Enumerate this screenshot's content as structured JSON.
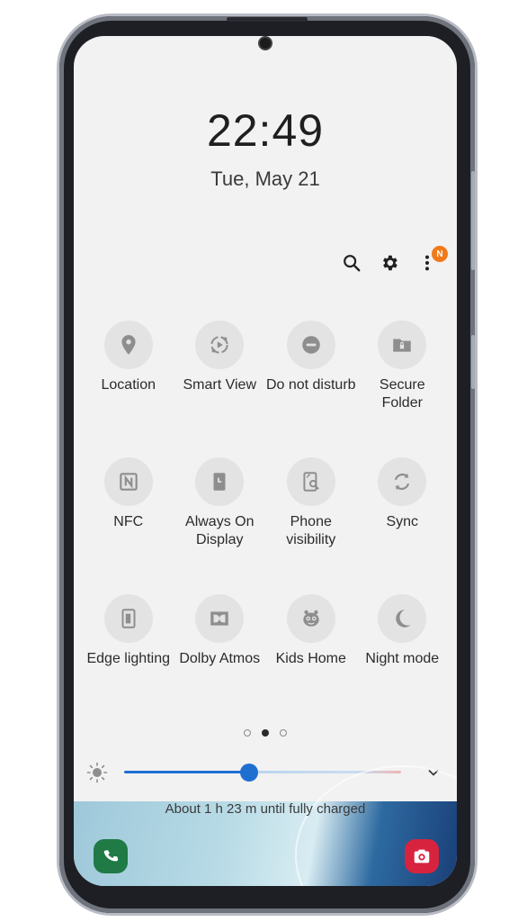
{
  "lockscreen": {
    "time": "22:49",
    "date": "Tue, May 21"
  },
  "top_actions": {
    "notification_badge": "N"
  },
  "tiles": [
    {
      "label": "Location",
      "icon": "location-pin-icon"
    },
    {
      "label": "Smart View",
      "icon": "smart-view-icon"
    },
    {
      "label": "Do not disturb",
      "icon": "do-not-disturb-icon"
    },
    {
      "label": "Secure Folder",
      "icon": "secure-folder-icon"
    },
    {
      "label": "NFC",
      "icon": "nfc-icon"
    },
    {
      "label": "Always On Display",
      "icon": "always-on-display-icon"
    },
    {
      "label": "Phone visibility",
      "icon": "phone-visibility-icon"
    },
    {
      "label": "Sync",
      "icon": "sync-icon"
    },
    {
      "label": "Edge lighting",
      "icon": "edge-lighting-icon"
    },
    {
      "label": "Dolby Atmos",
      "icon": "dolby-icon"
    },
    {
      "label": "Kids Home",
      "icon": "kids-home-icon"
    },
    {
      "label": "Night mode",
      "icon": "night-mode-icon"
    }
  ],
  "pager": {
    "pages": 3,
    "current": 2
  },
  "brightness": {
    "level": 0.45
  },
  "footer": {
    "charge_status": "About 1 h 23 m until fully charged"
  },
  "colors": {
    "accent": "#1f6fd1",
    "badge": "#f07a1a",
    "tile_bg": "#e3e3e3",
    "icon": "#8e8e8e"
  }
}
